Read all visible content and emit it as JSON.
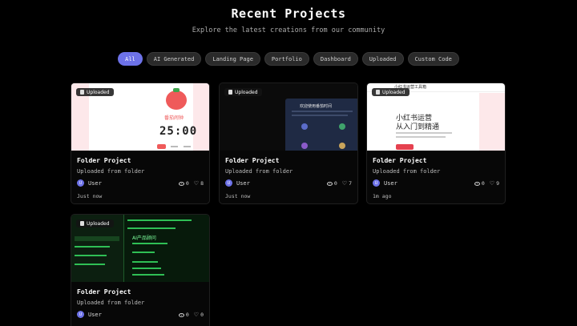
{
  "header": {
    "title": "Recent Projects",
    "subtitle": "Explore the latest creations from our community"
  },
  "filters": [
    {
      "label": "All",
      "active": true
    },
    {
      "label": "AI Generated",
      "active": false
    },
    {
      "label": "Landing Page",
      "active": false
    },
    {
      "label": "Portfolio",
      "active": false
    },
    {
      "label": "Dashboard",
      "active": false
    },
    {
      "label": "Uploaded",
      "active": false
    },
    {
      "label": "Custom Code",
      "active": false
    }
  ],
  "cards": [
    {
      "badge": "Uploaded",
      "title": "Folder Project",
      "desc": "Uploaded from folder",
      "author": "User",
      "avatar": "U",
      "views": "0",
      "likes": "8",
      "time": "Just now",
      "thumb": {
        "app_title": "番茄闹钟",
        "clock": "25:00"
      }
    },
    {
      "badge": "Uploaded",
      "title": "Folder Project",
      "desc": "Uploaded from folder",
      "author": "User",
      "avatar": "U",
      "views": "0",
      "likes": "7",
      "time": "Just now",
      "thumb": {
        "app_title": "欢迎使用番茄时间"
      }
    },
    {
      "badge": "Uploaded",
      "title": "Folder Project",
      "desc": "Uploaded from folder",
      "author": "User",
      "avatar": "U",
      "views": "0",
      "likes": "9",
      "time": "1m ago",
      "thumb": {
        "app_title": "小红书运营工具箱",
        "headline1": "小红书运营",
        "headline2": "从入门到精通"
      }
    },
    {
      "badge": "Uploaded",
      "title": "Folder Project",
      "desc": "Uploaded from folder",
      "author": "User",
      "avatar": "U",
      "views": "0",
      "likes": "0",
      "time": "",
      "thumb": {
        "app_title": "AI产品顾问"
      }
    }
  ],
  "colors": {
    "accent": "#6d72e8",
    "background": "#000000",
    "card_border": "#1f1f1f"
  }
}
